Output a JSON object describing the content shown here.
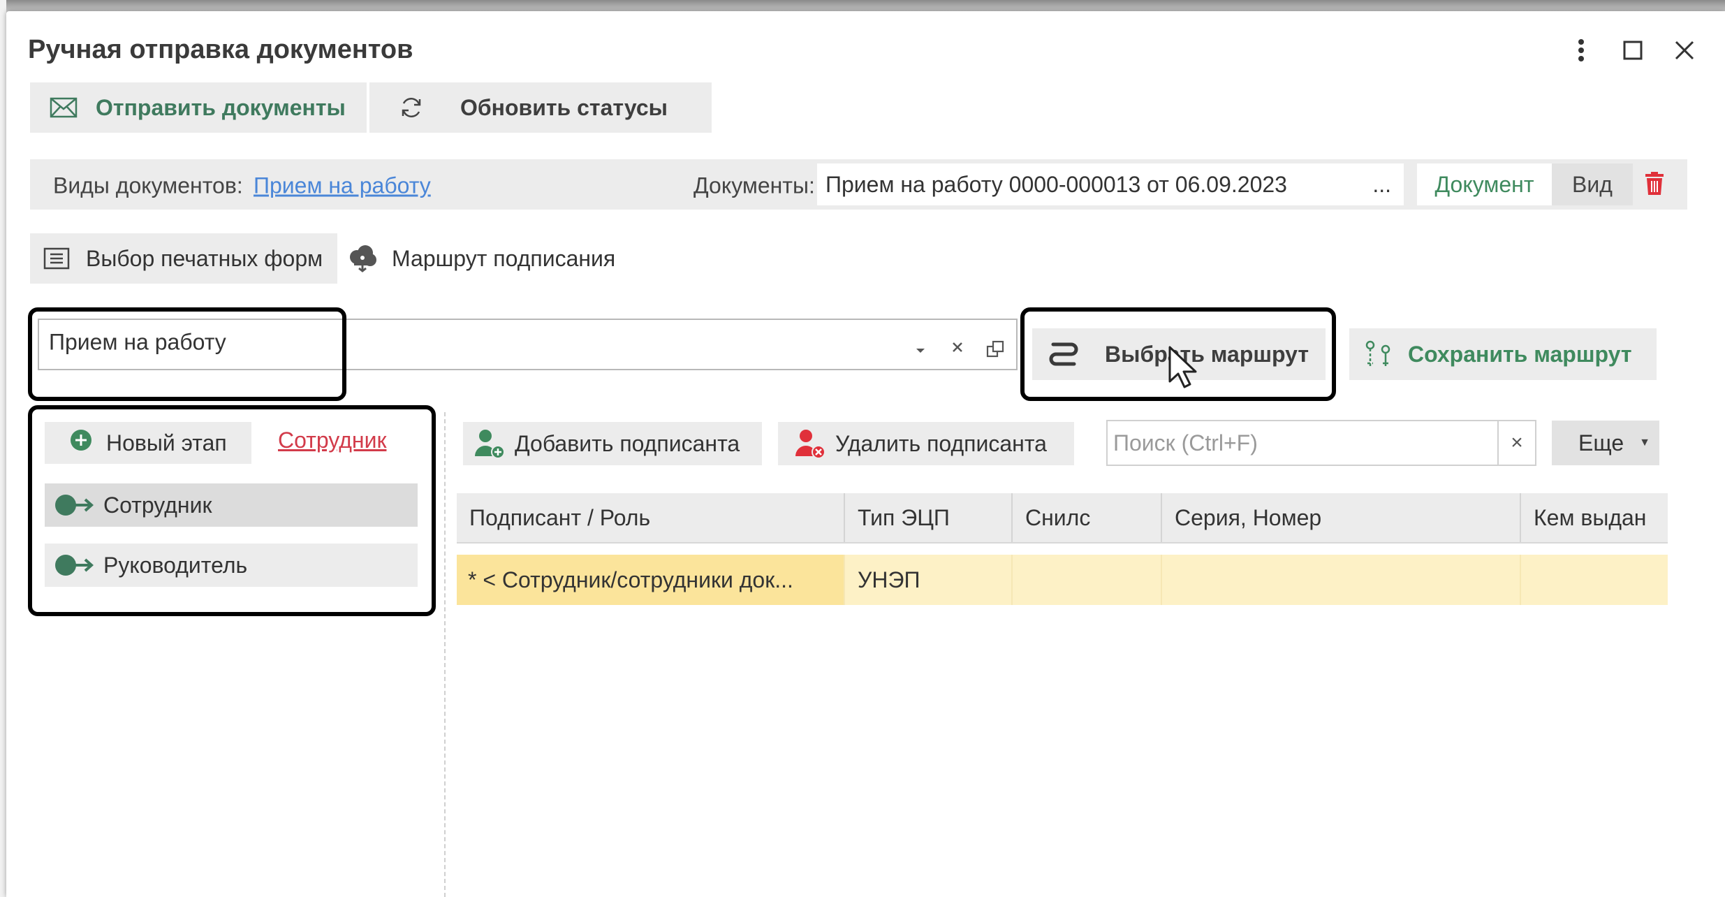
{
  "window": {
    "title": "Ручная отправка документов",
    "controls": [
      "more-vertical-icon",
      "maximize-icon",
      "close-icon"
    ]
  },
  "toolbar": {
    "send_label": "Отправить документы",
    "refresh_label": "Обновить статусы"
  },
  "filter": {
    "doc_types_label": "Виды документов:",
    "doc_types_value": "Прием на работу",
    "documents_label": "Документы:",
    "documents_value": "Прием на работу 0000-000013 от 06.09.2023",
    "documents_ellipsis": "...",
    "document_button": "Документ",
    "view_button": "Вид"
  },
  "tabs": {
    "print_forms": "Выбор печатных форм",
    "signing_route": "Маршрут подписания"
  },
  "route": {
    "combo_value": "Прием на работу",
    "choose_route": "Выбрать маршрут",
    "save_route": "Сохранить маршрут"
  },
  "stages": {
    "new_stage": "Новый этап",
    "employee_link": "Сотрудник",
    "items": [
      {
        "label": "Сотрудник",
        "selected": true
      },
      {
        "label": "Руководитель",
        "selected": false
      }
    ]
  },
  "signers": {
    "add": "Добавить подписанта",
    "remove": "Удалить подписанта",
    "search_placeholder": "Поиск (Ctrl+F)",
    "search_clear": "×",
    "more": "Еще"
  },
  "table": {
    "columns": [
      "Подписант / Роль",
      "Тип ЭЦП",
      "Снилс",
      "Серия, Номер",
      "Кем выдан"
    ],
    "rows": [
      [
        "* < Сотрудник/сотрудники док...",
        "УНЭП",
        "",
        "",
        ""
      ]
    ]
  },
  "colors": {
    "accent_green": "#3f7a5e",
    "link_blue": "#4a86d8",
    "link_red": "#d23b4a",
    "row_highlight": "#fdf1c6",
    "trash_red": "#e0303a"
  }
}
